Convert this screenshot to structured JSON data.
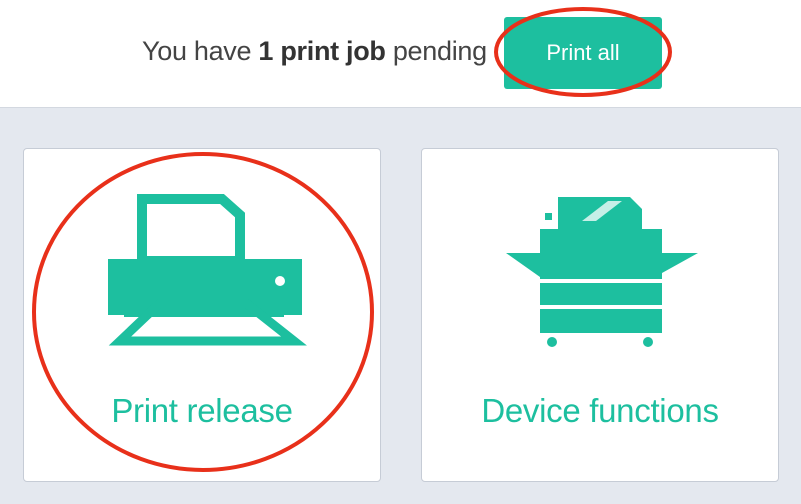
{
  "header": {
    "pending_prefix": "You have ",
    "pending_bold": "1 print job",
    "pending_suffix": " pending",
    "print_all_label": "Print all"
  },
  "tiles": [
    {
      "label": "Print release",
      "icon": "printer-icon"
    },
    {
      "label": "Device functions",
      "icon": "copier-icon"
    }
  ],
  "colors": {
    "accent": "#1dbf9f",
    "annotation": "#e8301a",
    "background": "#e4e8ef"
  }
}
